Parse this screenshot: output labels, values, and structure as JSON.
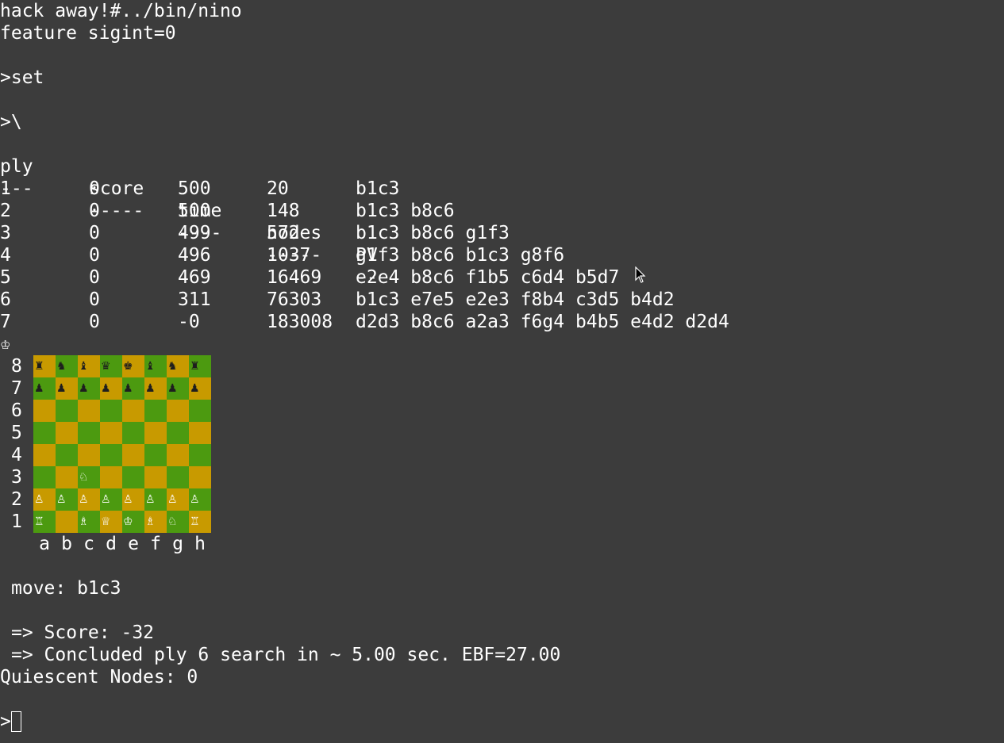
{
  "terminal": {
    "header_lines": [
      "hack away!#../bin/nino",
      "feature sigint=0",
      "",
      ">set",
      "",
      ">\\"
    ],
    "table": {
      "headers": [
        "ply",
        "score",
        "time",
        "nodes",
        "PV"
      ],
      "underlines": [
        "---",
        "-----",
        "----",
        "-----",
        "--"
      ],
      "rows": [
        [
          "1",
          "0",
          "500",
          "20",
          "b1c3"
        ],
        [
          "2",
          "0",
          "500",
          "148",
          "b1c3 b8c6"
        ],
        [
          "3",
          "0",
          "499",
          "572",
          "b1c3 b8c6 g1f3"
        ],
        [
          "4",
          "0",
          "496",
          "1037",
          "g1f3 b8c6 b1c3 g8f6"
        ],
        [
          "5",
          "0",
          "469",
          "16469",
          "e2e4 b8c6 f1b5 c6d4 b5d7"
        ],
        [
          "6",
          "0",
          "311",
          "76303",
          "b1c3 e7e5 e2e3 f8b4 c3d5 b4d2"
        ],
        [
          "7",
          "0",
          "-0",
          "183008",
          "d2d3 b8c6 a2a3 f6g4 b4b5 e4d2 d2d4"
        ]
      ]
    },
    "turn_symbol": "♔",
    "board": {
      "rank_labels": [
        "8",
        "7",
        "6",
        "5",
        "4",
        "3",
        "2",
        "1"
      ],
      "file_labels": [
        "a",
        "b",
        "c",
        "d",
        "e",
        "f",
        "g",
        "h"
      ],
      "light_color": "#c89a00",
      "dark_color": "#4c9a10",
      "position": [
        [
          "♜",
          "♞",
          "♝",
          "♛",
          "♚",
          "♝",
          "♞",
          "♜"
        ],
        [
          "♟",
          "♟",
          "♟",
          "♟",
          "♟",
          "♟",
          "♟",
          "♟"
        ],
        [
          "",
          "",
          "",
          "",
          "",
          "",
          "",
          ""
        ],
        [
          "",
          "",
          "",
          "",
          "",
          "",
          "",
          ""
        ],
        [
          "",
          "",
          "",
          "",
          "",
          "",
          "",
          ""
        ],
        [
          "",
          "",
          "♘",
          "",
          "",
          "",
          "",
          ""
        ],
        [
          "♙",
          "♙",
          "♙",
          "♙",
          "♙",
          "♙",
          "♙",
          "♙"
        ],
        [
          "♖",
          "",
          "♗",
          "♕",
          "♔",
          "♗",
          "♘",
          "♖"
        ]
      ]
    },
    "move_line": "move: b1c3",
    "score_line": "=> Score: -32",
    "concluded_line": "=> Concluded ply 6 search in ~ 5.00 sec. EBF=27.00",
    "quiescent_line": "Quiescent Nodes: 0",
    "prompt": ">"
  }
}
